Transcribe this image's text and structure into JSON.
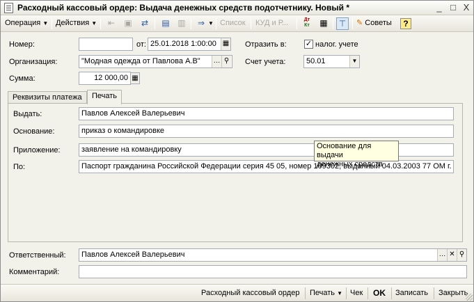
{
  "window": {
    "title": "Расходный кассовый ордер: Выдача денежных средств подотчетнику. Новый *",
    "minimize": "_",
    "maximize": "□",
    "close": "X"
  },
  "toolbar": {
    "operation": "Операция",
    "actions": "Действия",
    "list": "Список",
    "kud": "КУД и Р...",
    "dtkt_top": "Дт",
    "dtkt_bottom": "Кт",
    "advice": "Советы",
    "help": "?"
  },
  "form": {
    "number_label": "Номер:",
    "number_value": "",
    "from_label": "от:",
    "date_value": "25.01.2018  1:00:00",
    "reflect_label": "Отразить в:",
    "tax_checkbox_label": "налог. учете",
    "tax_checked": "✓",
    "org_label": "Организация:",
    "org_value": "\"Модная одежда от Павлова А.В\"",
    "account_label": "Счет учета:",
    "account_value": "50.01",
    "sum_label": "Сумма:",
    "sum_value": "12 000,00"
  },
  "tabs": [
    {
      "label": "Реквизиты платежа"
    },
    {
      "label": "Печать"
    }
  ],
  "print_tab": {
    "issue_label": "Выдать:",
    "issue_value": "Павлов Алексей Валерьевич",
    "basis_label": "Основание:",
    "basis_value": "приказ о командировке",
    "attachment_label": "Приложение:",
    "attachment_value": "заявление на командировку",
    "by_label": "По:",
    "by_value": "Паспорт гражданина Российской Федерации серия 45 05, номер 109302, выданный 04.03.2003 77 ОМ г."
  },
  "tooltip": {
    "line1": "Основание для выдачи",
    "line2": "денежных средств"
  },
  "footer_fields": {
    "responsible_label": "Ответственный:",
    "responsible_value": "Павлов Алексей Валерьевич",
    "comment_label": "Комментарий:",
    "comment_value": ""
  },
  "bottom_buttons": {
    "print_form": "Расходный кассовый ордер",
    "print": "Печать",
    "check": "Чек",
    "ok": "OK",
    "save": "Записать",
    "close": "Закрыть"
  },
  "colors": {
    "accent_blue": "#2b5aa8",
    "tooltip_bg": "#ffffe1",
    "window_bg": "#f2f1ea"
  }
}
